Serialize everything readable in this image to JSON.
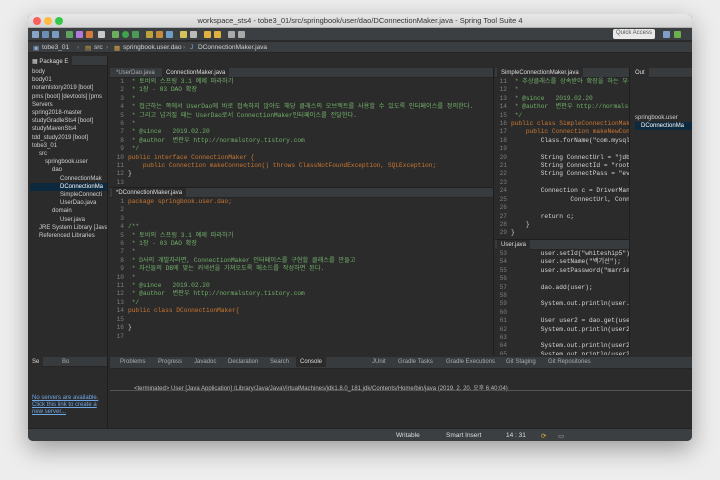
{
  "window": {
    "title": "workspace_sts4 - tobe3_01/src/springbook/user/dao/DConnectionMaker.java - Spring Tool Suite 4"
  },
  "toolbar": {
    "quick_access": "Quick Access"
  },
  "breadcrumb": [
    "tobe3_01",
    "src",
    "springbook.user.dao",
    "DConnectionMaker.java"
  ],
  "package_explorer": {
    "tab": "Package E",
    "items": [
      "body",
      "body01",
      "noramlstory2019 [boot]",
      "pms [boot] [devtools] [pms",
      "Servers",
      "spring2018-master",
      "studyGradleSts4 [boot]",
      "studyMavenSts4",
      "tdd_study2019 [boot]",
      "tobe3_01",
      "src",
      "springbook.user",
      "dao",
      "ConnectionMak",
      "DConnectionMa",
      "SimpleConnecti",
      "UserDao.java",
      "domain",
      "User.java",
      "JRE System Library [Java",
      "Referenced Libraries"
    ]
  },
  "top_editor": {
    "tabs": [
      "*UserDao.java",
      "ConnectionMaker.java"
    ],
    "lines": [
      {
        "n": "1",
        "t": " * 토비의 스프링 3.1 예제 따라하기"
      },
      {
        "n": "2",
        "t": " * 1장 - 03 DAO 확장"
      },
      {
        "n": "3",
        "t": " *"
      },
      {
        "n": "4",
        "t": " * 접근하는 쪽에서 UserDao에 바로 접속하지 않아도 해당 클래스의 오브젝트를 사용할 수 있도록 인터페이스를 정의한다."
      },
      {
        "n": "5",
        "t": " * 그리고 넘겨질 때는 UserDao로서 ConnectionMaker인터페이스를 전달한다."
      },
      {
        "n": "6",
        "t": " *"
      },
      {
        "n": "7",
        "t": " * @since   2019.02.20"
      },
      {
        "n": "8",
        "t": " * @author  변판우 http://normalstory.tistory.com"
      },
      {
        "n": "9",
        "t": " */"
      },
      {
        "n": "10",
        "t": "public interface ConnectionMaker {"
      },
      {
        "n": "11",
        "t": "    public Connection makeConnection() throws ClassNotFoundException, SQLException;"
      },
      {
        "n": "12",
        "t": "}"
      },
      {
        "n": "13",
        "t": ""
      }
    ]
  },
  "bottom_editor": {
    "tab": "*DConnectionMaker.java",
    "lines": [
      {
        "n": "1",
        "t": "package springbook.user.dao;"
      },
      {
        "n": "2",
        "t": ""
      },
      {
        "n": "3",
        "t": ""
      },
      {
        "n": "4",
        "t": "/**"
      },
      {
        "n": "5",
        "t": " * 토비의 스프링 3.1 예제 따라하기"
      },
      {
        "n": "6",
        "t": " * 1장 - 03 DAO 확장"
      },
      {
        "n": "7",
        "t": " *"
      },
      {
        "n": "8",
        "t": " * D사의 개발자라면, ConnectionMaker 인터페이스를 구현할 클래스를 만들고"
      },
      {
        "n": "9",
        "t": " * 자신들의 DB에 맞는 커넥션을 가져오도록 메소드를 작성하면 된다."
      },
      {
        "n": "10",
        "t": " *"
      },
      {
        "n": "11",
        "t": " * @since   2019.02.20"
      },
      {
        "n": "12",
        "t": " * @author  변판우 http://normalstory.tistory.com"
      },
      {
        "n": "13",
        "t": " */"
      },
      {
        "n": "14",
        "t": "public class DConnectionMaker{"
      },
      {
        "n": "15",
        "t": ""
      },
      {
        "n": "16",
        "t": "}"
      },
      {
        "n": "17",
        "t": ""
      }
    ]
  },
  "right_top_editor": {
    "tab": "SimpleConnectionMaker.java",
    "lines": [
      {
        "n": "11",
        "t": " * 추상클래스를 상속받아 확장을 하는 부분!"
      },
      {
        "n": "12",
        "t": " *"
      },
      {
        "n": "13",
        "t": " * @since   2019.02.20"
      },
      {
        "n": "14",
        "t": " * @author  변판우 http://normalsto"
      },
      {
        "n": "15",
        "t": " */"
      },
      {
        "n": "16",
        "t": "public class SimpleConnectionMaker {"
      },
      {
        "n": "17",
        "t": "    public Connection makeNewConnec"
      },
      {
        "n": "18",
        "t": "        Class.forName(\"com.mysql."
      },
      {
        "n": "19",
        "t": ""
      },
      {
        "n": "20",
        "t": "        String ConnectUrl = \"jdbc"
      },
      {
        "n": "21",
        "t": "        String ConnectId = \"root"
      },
      {
        "n": "22",
        "t": "        String ConnectPass = \"ev"
      },
      {
        "n": "23",
        "t": ""
      },
      {
        "n": "24",
        "t": "        Connection c = DriverMan"
      },
      {
        "n": "25",
        "t": "                ConnectUrl, Conn"
      },
      {
        "n": "26",
        "t": ""
      },
      {
        "n": "27",
        "t": "        return c;"
      },
      {
        "n": "28",
        "t": "    }"
      },
      {
        "n": "29",
        "t": "}"
      },
      {
        "n": "30",
        "t": ""
      }
    ]
  },
  "right_bottom_editor": {
    "tab": "User.java",
    "lines": [
      {
        "n": "53",
        "t": "        user.setId(\"whiteship5\")"
      },
      {
        "n": "54",
        "t": "        user.setName(\"백기선\");"
      },
      {
        "n": "55",
        "t": "        user.setPassword(\"married"
      },
      {
        "n": "56",
        "t": ""
      },
      {
        "n": "57",
        "t": "        dao.add(user);"
      },
      {
        "n": "58",
        "t": ""
      },
      {
        "n": "59",
        "t": "        System.out.println(user."
      },
      {
        "n": "60",
        "t": ""
      },
      {
        "n": "61",
        "t": "        User user2 = dao.get(user"
      },
      {
        "n": "62",
        "t": "        System.out.println(user2"
      },
      {
        "n": "63",
        "t": ""
      },
      {
        "n": "64",
        "t": "        System.out.println(user2"
      },
      {
        "n": "65",
        "t": "        System.out.println(user2"
      },
      {
        "n": "66",
        "t": "    }"
      },
      {
        "n": "67",
        "t": ""
      }
    ]
  },
  "outline": {
    "tab": "Out",
    "items": [
      "springbook.user",
      "DConnectionMa"
    ]
  },
  "servers": {
    "tabs": [
      "Se",
      "Bo"
    ],
    "link": "No servers are available. Click this link to create a new server..."
  },
  "console": {
    "tabs": [
      "Problems",
      "Progress",
      "Javadoc",
      "Declaration",
      "Search",
      "Console",
      "JUnit",
      "Gradle Tasks",
      "Gradle Executions",
      "Git Staging",
      "Git Repositories"
    ],
    "terminated": "<terminated> User [Java Application] /Library/Java/JavaVirtualMachines/jdk1.8.0_181.jdk/Contents/Home/bin/java (2019. 2. 20. 오후 6:40:04)"
  },
  "status": {
    "writable": "Writable",
    "insert": "Smart Insert",
    "pos": "14 : 31"
  }
}
